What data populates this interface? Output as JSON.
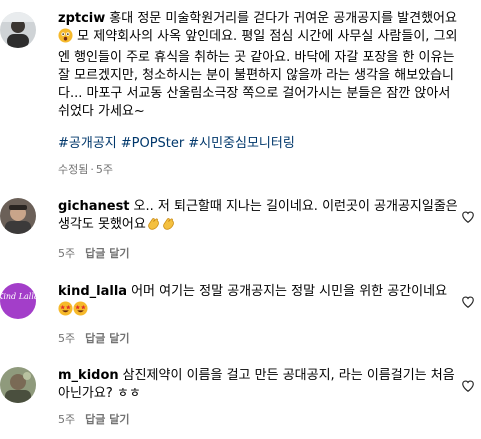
{
  "post": {
    "username": "zptciw",
    "body_1": "홍대 정문 미술학원거리를 걷다가 귀여운 공개공지를 발견했어요",
    "body_2": "모 제약회사의 사옥 앞인데요. 평일 점심 시간에 사무실 사람들이, 그외엔 행인들이 주로 휴식을 취하는 곳 같아요. 바닥에 자갈 포장을 한 이유는 잘 모르겠지만, 청소하시는 분이 불편하지 않을까 라는 생각을 해보았습니다... 마포구 서교동 산울림소극장 쪽으로 걸어가시는 분들은 잠깐 앉아서 쉬었다 가세요~",
    "hashtags": [
      "#공개공지",
      "#POPSter",
      "#시민중심모니터링"
    ],
    "edited": "수정됨",
    "time": "5주"
  },
  "comments": [
    {
      "username": "gichanest",
      "text": "오.. 저 퇴근할때 지나는 길이네요. 이런곳이 공개공지일줄은 생각도 못했어요",
      "time": "5주",
      "reply": "답글 달기"
    },
    {
      "username": "kind_lalla",
      "text": "어머 여기는 정말 공개공지는 정말 시민을 위한 공간이네요",
      "avatar_text": "Kind Lalla",
      "time": "5주",
      "reply": "답글 달기"
    },
    {
      "username": "m_kidon",
      "text": "삼진제약이 이름을 걸고 만든 공대공지, 라는 이름걸기는 처음 아닌가요? ㅎㅎ",
      "time": "5주",
      "reply": "답글 달기"
    }
  ],
  "icons": {
    "heart": "heart-outline-icon",
    "clap": "clapping-hands-emoji",
    "star_eyes": "star-struck-emoji",
    "astonished": "astonished-face-emoji"
  },
  "colors": {
    "hashtag": "#00376b",
    "meta": "#737373",
    "kind_lalla_avatar": "#a33ec9"
  }
}
